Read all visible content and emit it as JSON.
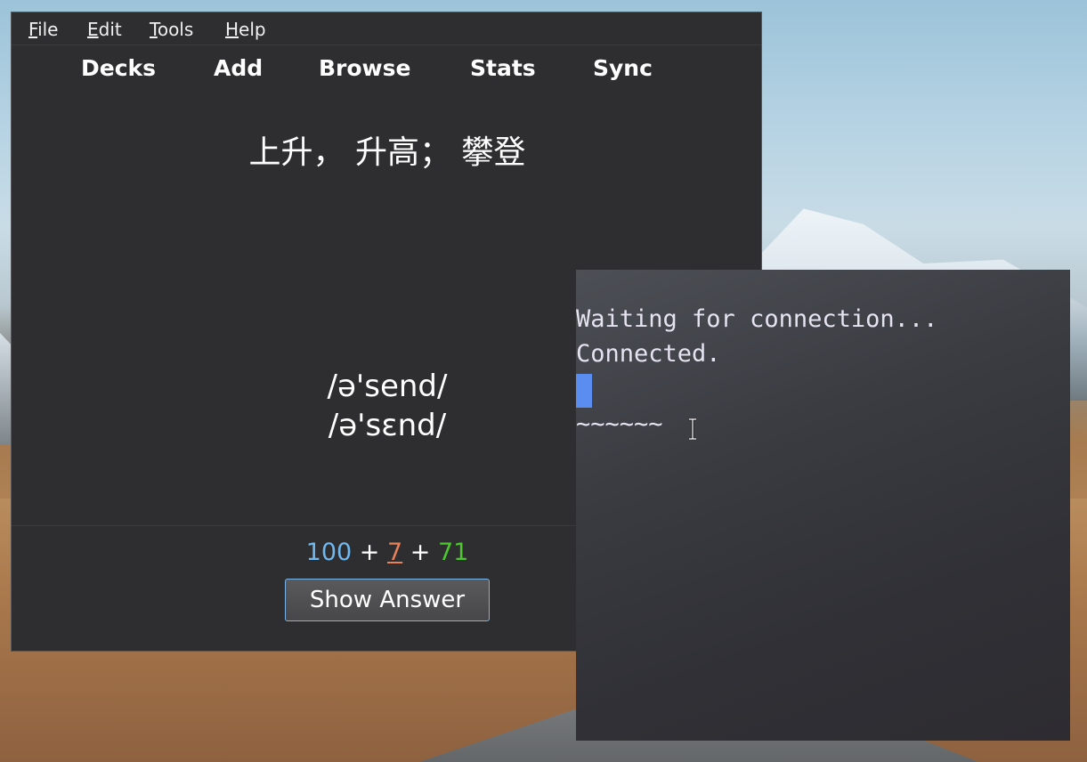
{
  "menubar": {
    "items": [
      {
        "accel": "F",
        "rest": "ile"
      },
      {
        "accel": "E",
        "rest": "dit"
      },
      {
        "accel": "T",
        "rest": "ools"
      },
      {
        "accel": "H",
        "rest": "elp"
      }
    ]
  },
  "toolbar": {
    "decks": "Decks",
    "add": "Add",
    "browse": "Browse",
    "stats": "Stats",
    "sync": "Sync"
  },
  "card": {
    "question": "上升， 升高； 攀登",
    "ipa_1": "/ə'send/",
    "ipa_2": "/ə'sɛnd/"
  },
  "counts": {
    "new": "100",
    "sep1": " + ",
    "learn": "7",
    "sep2": " + ",
    "due": "71"
  },
  "buttons": {
    "show_answer": "Show Answer"
  },
  "terminal": {
    "line1": "Waiting for connection...",
    "line2": "Connected.",
    "line4": "~~~~~~"
  },
  "colors": {
    "new": "#6fb8f0",
    "learn": "#e8805a",
    "due": "#4cc82e",
    "cursor": "#5b8cf0"
  }
}
